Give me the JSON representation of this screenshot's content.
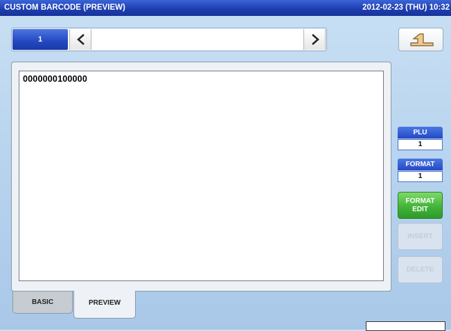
{
  "window": {
    "title": "CUSTOM BARCODE (PREVIEW)",
    "datetime": "2012-02-23 (THU) 10:32"
  },
  "navigation": {
    "page_number": "1",
    "field_value": "",
    "prev_icon": "chevron-left-icon",
    "next_icon": "chevron-right-icon",
    "back_icon": "return-arrow-icon"
  },
  "preview": {
    "content": "0000000100000"
  },
  "sidebar": {
    "plu_label": "PLU",
    "plu_value": "1",
    "format_label": "FORMAT",
    "format_value": "1",
    "format_edit_line1": "FORMAT",
    "format_edit_line2": "EDIT",
    "insert_label": "INSERT",
    "delete_label": "DELETE"
  },
  "tabs": {
    "basic": "BASIC",
    "preview": "PREVIEW"
  },
  "colors": {
    "title_bar": "#1f3fb0",
    "accent_blue": "#2447c0",
    "format_edit_green": "#43b53a",
    "background": "#b7d3ee"
  }
}
